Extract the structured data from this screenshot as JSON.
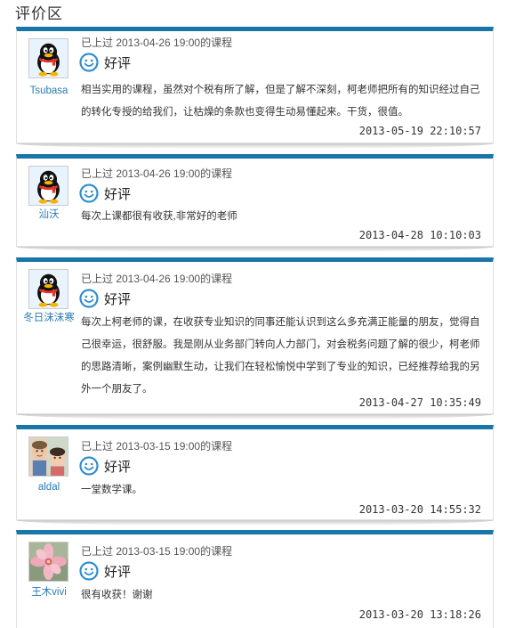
{
  "section": {
    "title": "评价区"
  },
  "reviews": [
    {
      "username": "Tsubasa",
      "course": "已上过 2013-04-26 19:00的课程",
      "rating": "好评",
      "comment": "相当实用的课程，虽然对个税有所了解，但是了解不深刻，柯老师把所有的知识经过自己的转化专授的给我们，让枯燥的条款也变得生动易懂起来。干货，很值。",
      "time": "2013-05-19 22:10:57",
      "avatar_icon": "qq-penguin-icon"
    },
    {
      "username": "汕沃",
      "course": "已上过 2013-04-26 19:00的课程",
      "rating": "好评",
      "comment": "每次上课都很有收获,非常好的老师",
      "time": "2013-04-28 10:10:03",
      "avatar_icon": "qq-penguin-icon"
    },
    {
      "username": "冬日沫沫寒",
      "course": "已上过 2013-04-26 19:00的课程",
      "rating": "好评",
      "comment": "每次上柯老师的课，在收获专业知识的同事还能认识到这么多充满正能量的朋友，觉得自己很幸运，很舒服。我是刚从业务部门转向人力部门，对会税务问题了解的很少，柯老师的思路清晰，案例幽默生动，让我们在轻松愉悦中学到了专业的知识，已经推荐给我的另外一个朋友了。",
      "time": "2013-04-27 10:35:49",
      "avatar_icon": "qq-penguin-icon"
    },
    {
      "username": "aldal",
      "course": "已上过 2013-03-15 19:00的课程",
      "rating": "好评",
      "comment": "一堂数学课。",
      "time": "2013-03-20 14:55:32",
      "avatar_icon": "child-photo-icon"
    },
    {
      "username": "王木vivi",
      "course": "已上过 2013-03-15 19:00的课程",
      "rating": "好评",
      "comment": "很有收获！谢谢",
      "time": "2013-03-20 13:18:26",
      "avatar_icon": "flower-photo-icon"
    }
  ],
  "colors": {
    "accent": "#1976a8",
    "link": "#2a7ab8"
  }
}
